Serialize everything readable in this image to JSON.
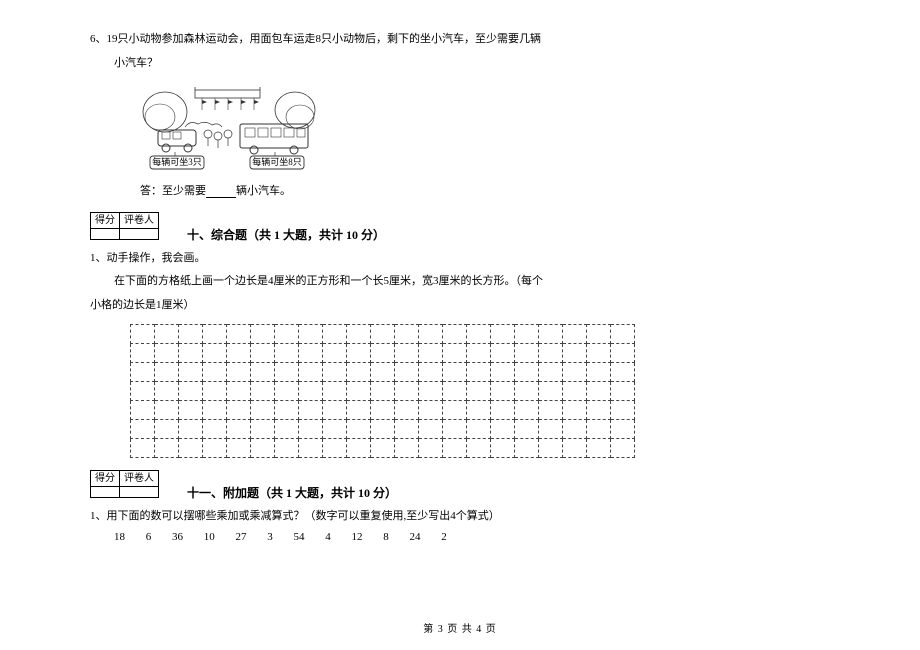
{
  "q6": {
    "number": "6、",
    "text_line1": "19只小动物参加森林运动会，用面包车运走8只小动物后，剩下的坐小汽车，至少需要几辆",
    "text_line2": "小汽车？",
    "caption_left": "每辆可坐3只",
    "caption_right": "每辆可坐8只",
    "answer_prefix": "答：至少需要",
    "answer_suffix": "辆小汽车。"
  },
  "score_table": {
    "col1": "得分",
    "col2": "评卷人"
  },
  "section10": {
    "title": "十、综合题（共 1 大题，共计 10 分）",
    "q1_num": "1、",
    "q1_line1": "动手操作，我会画。",
    "q1_line2": "在下面的方格纸上画一个边长是4厘米的正方形和一个长5厘米，宽3厘米的长方形。（每个",
    "q1_line3": "小格的边长是1厘米）"
  },
  "section11": {
    "title": "十一、附加题（共 1 大题，共计 10 分）",
    "q1_num": "1、",
    "q1_text": "用下面的数可以摆哪些乘加或乘减算式？（数字可以重复使用,至少写出4个算式）",
    "numbers": [
      "18",
      "6",
      "36",
      "10",
      "27",
      "3",
      "54",
      "4",
      "12",
      "8",
      "24",
      "2"
    ]
  },
  "footer": "第 3 页 共 4 页"
}
